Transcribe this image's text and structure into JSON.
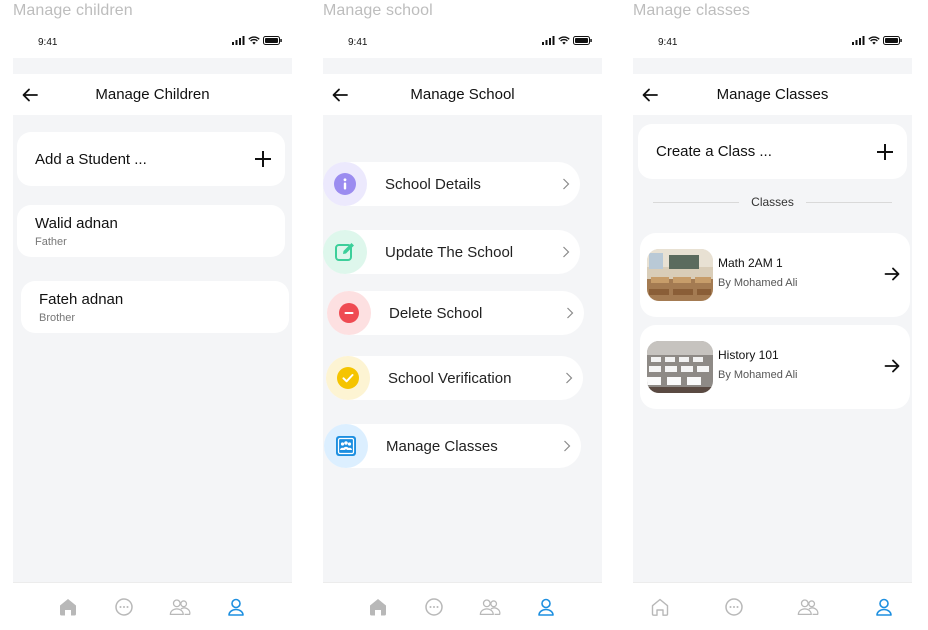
{
  "screens": [
    {
      "frame_label": "Manage children",
      "status_time": "9:41",
      "title": "Manage Children",
      "add_label": "Add a Student ...",
      "children": [
        {
          "name": "Walid adnan",
          "relation": "Father"
        },
        {
          "name": "Fateh adnan",
          "relation": "Brother"
        }
      ]
    },
    {
      "frame_label": "Manage school",
      "status_time": "9:41",
      "title": "Manage School",
      "menu": [
        {
          "label": "School Details",
          "icon": "info-icon",
          "color": "#9b8cf0",
          "bg": "#ece9fd"
        },
        {
          "label": "Update The School",
          "icon": "edit-icon",
          "color": "#3ccf9a",
          "bg": "#def7ec"
        },
        {
          "label": "Delete School",
          "icon": "delete-icon",
          "color": "#ef4b52",
          "bg": "#fde0e1"
        },
        {
          "label": "School Verification",
          "icon": "check-icon",
          "color": "#f5c400",
          "bg": "#fdf4d3"
        },
        {
          "label": "Manage Classes",
          "icon": "classroom-icon",
          "color": "#1d8fe0",
          "bg": "#dcefff"
        }
      ]
    },
    {
      "frame_label": "Manage classes",
      "status_time": "9:41",
      "title": "Manage Classes",
      "add_label": "Create a Class ...",
      "section_label": "Classes",
      "classes": [
        {
          "title": "Math 2AM 1",
          "teacher": "By Mohamed Ali",
          "thumb": "classroom-photo"
        },
        {
          "title": "History 101",
          "teacher": "By Mohamed Ali",
          "thumb": "exam-hall-photo"
        }
      ]
    }
  ],
  "nav": {
    "items": [
      "home-icon",
      "chat-icon",
      "users-icon",
      "profile-icon"
    ],
    "active": "profile-icon",
    "active_color": "#1d8fe0",
    "inactive_color": "#b8b8b8"
  }
}
